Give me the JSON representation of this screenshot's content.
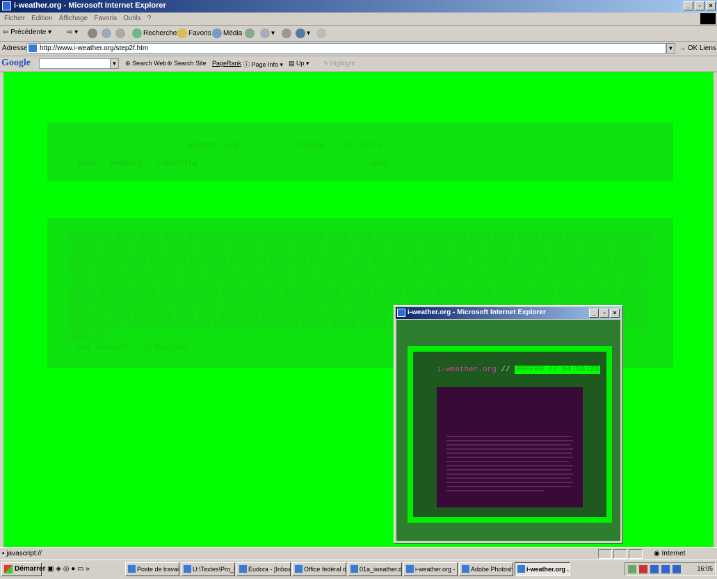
{
  "window": {
    "title": "i-weather.org - Microsoft Internet Explorer"
  },
  "menu": [
    "Fichier",
    "Edition",
    "Affichage",
    "Favoris",
    "Outils",
    "?"
  ],
  "toolbar": {
    "back": "Précédente",
    "search": "Rechercher",
    "favorites": "Favoris",
    "media": "Média"
  },
  "address": {
    "label": "Adresse",
    "url": "http://www.i-weather.org/step2f.htm",
    "go": "OK",
    "links": "Liens"
  },
  "google": {
    "logo": "Google",
    "search_web": "Search Web",
    "search_site": "Search Site",
    "pagerank": "PageRank",
    "page_info": "Page Info",
    "up": "Up",
    "highlight": "Highlight"
  },
  "page": {
    "site": "i-weather.org",
    "color_time": "7FD36AE // 11:47:16",
    "nav": [
      "Home",
      "members",
      "subscribe"
    ],
    "next": "next",
    "lang": [
      "auf Deutsch",
      "in English"
    ]
  },
  "popup": {
    "title": "i-weather.org - Microsoft Internet Explorer",
    "site": "i-weather.org",
    "sep": "//",
    "color_time": "00FF00 // 04:56:23"
  },
  "status": {
    "text": "javascript://",
    "zone": "Internet"
  },
  "taskbar": {
    "start": "Démarrer",
    "tasks": [
      "Poste de travail",
      "U:\\Textes\\Pro_H...",
      "Eudora - [Inbox (...",
      "Office fédéral de...",
      "01a_iweather.do...",
      "i-weather.org - ...",
      "Adobe Photoshop",
      "i-weather.org ..."
    ],
    "clock": "16:05"
  },
  "colors": {
    "page_bg": "#00ff00",
    "popup_frame": "#00ee00",
    "popup_mini_bg": "#3a0a36",
    "title_pink": "#d040a0"
  }
}
